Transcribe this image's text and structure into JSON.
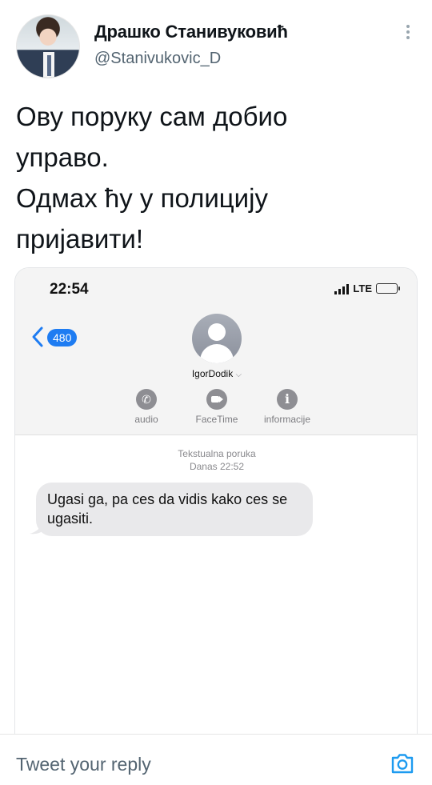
{
  "tweet": {
    "author_name": "Драшко Станивуковић",
    "author_handle": "@Stanivukovic_D",
    "text_lines": [
      "Ову поруку сам добио",
      "управо.",
      "Одмах ћу у полицију",
      "пријавити!"
    ]
  },
  "screenshot": {
    "time": "22:54",
    "network": "LTE",
    "unread_count": "480",
    "contact_name": "IgorDodik",
    "actions": [
      "audio",
      "FaceTime",
      "informacije"
    ],
    "message_type": "Tekstualna poruka",
    "message_time": "Danas 22:52",
    "message_text": "Ugasi ga, pa ces da vidis kako ces se ugasiti."
  },
  "reply": {
    "placeholder": "Tweet your reply"
  },
  "colors": {
    "accent": "#1d9bf0",
    "ios_blue": "#1e7cf2",
    "bubble": "#e9e9eb"
  },
  "icons": [
    "avatar",
    "more-icon",
    "back-chevron-icon",
    "contact-avatar-icon",
    "phone-icon",
    "video-camera-icon",
    "info-icon",
    "camera-icon"
  ]
}
